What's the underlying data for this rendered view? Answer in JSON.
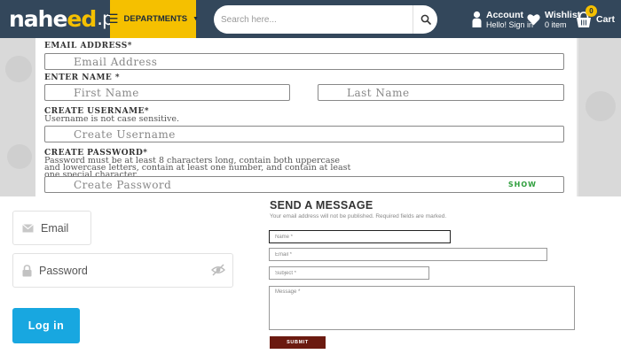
{
  "header": {
    "logo_main": "nahe",
    "logo_accent": "ed",
    "logo_suffix": ".pk",
    "departments_label": "DEPARTMENTS",
    "search_placeholder": "Search here...",
    "account_title": "Account",
    "account_sub": "Hello! Sign in",
    "wishlist_title": "Wishlist",
    "wishlist_sub": "0 item",
    "cart_label": "Cart",
    "cart_count": "0",
    "icons": [
      "menu-icon",
      "search-icon",
      "user-icon",
      "heart-icon",
      "basket-icon"
    ]
  },
  "registration": {
    "email_label": "EMAIL ADDRESS*",
    "email_placeholder": "Email Address",
    "name_label": "ENTER NAME *",
    "first_name_placeholder": "First Name",
    "last_name_placeholder": "Last Name",
    "username_label": "CREATE USERNAME*",
    "username_note": "Username is not case sensitive.",
    "username_placeholder": "Create Username",
    "password_label": "CREATE PASSWORD*",
    "password_note_1": "Password must be at least 8 characters long, contain both uppercase",
    "password_note_2": "and lowercase letters, contain at least one number, and contain at least",
    "password_note_3": "one special character.",
    "password_placeholder": "Create Password",
    "show_label": "SHOW"
  },
  "login": {
    "email_placeholder": "Email",
    "password_placeholder": "Password",
    "login_button": "Log in"
  },
  "contact": {
    "title": "SEND A MESSAGE",
    "subtitle": "Your email address will not be published. Required fields are marked.",
    "name_placeholder": "Name *",
    "email_placeholder": "Email *",
    "subject_placeholder": "Subject *",
    "message_placeholder": "Message *",
    "submit_label": "SUBMIT"
  },
  "colors": {
    "header_bg": "#33475b",
    "accent_yellow": "#f5c000",
    "login_blue": "#18a7e0",
    "submit_maroon": "#6b1a10",
    "show_green": "#2e9e3c"
  }
}
